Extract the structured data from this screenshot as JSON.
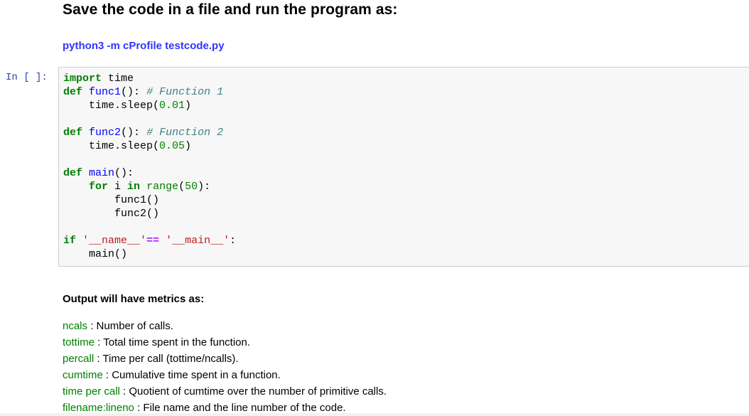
{
  "heading": "Save the code in a file and run the program as:",
  "command": {
    "text": "python3 -m cProfile testcode.py",
    "color": "#3333ff"
  },
  "cell": {
    "prompt": "In [ ]:",
    "code": {
      "l1_kw": "import",
      "l1_rest": " time",
      "l2_kw": "def",
      "l2_fn": "func1",
      "l2_mid": "(): ",
      "l2_cm": "# Function 1",
      "l3_a": "    time.sleep(",
      "l3_num": "0.01",
      "l3_b": ")",
      "l5_kw": "def",
      "l5_fn": "func2",
      "l5_mid": "(): ",
      "l5_cm": "# Function 2",
      "l6_a": "    time.sleep(",
      "l6_num": "0.05",
      "l6_b": ")",
      "l8_kw": "def",
      "l8_fn": "main",
      "l8_rest": "():",
      "l9_kw1": "for",
      "l9_mid": " i ",
      "l9_kw2": "in",
      "l9_bi": "range",
      "l9_a": "(",
      "l9_num": "50",
      "l9_b": "):",
      "l10": "        func1()",
      "l11": "        func2()",
      "l13_kw": "if",
      "l13_s1": "'__name__'",
      "l13_op": "==",
      "l13_s2": "'__main__'",
      "l13_end": ":",
      "l14": "    main()"
    }
  },
  "output_heading": "Output will have metrics as:",
  "metrics": [
    {
      "term": "ncals",
      "desc": " : Number of calls."
    },
    {
      "term": "tottime",
      "desc": " : Total time spent in the function."
    },
    {
      "term": "percall",
      "desc": " : Time per call (tottime/ncalls)."
    },
    {
      "term": "cumtime",
      "desc": " : Cumulative time spent in a function."
    },
    {
      "term": "time per call",
      "desc": " : Quotient of cumtime over the number of primitive calls."
    },
    {
      "term": "filename:lineno",
      "desc": " : File name and the line number of the code."
    }
  ]
}
